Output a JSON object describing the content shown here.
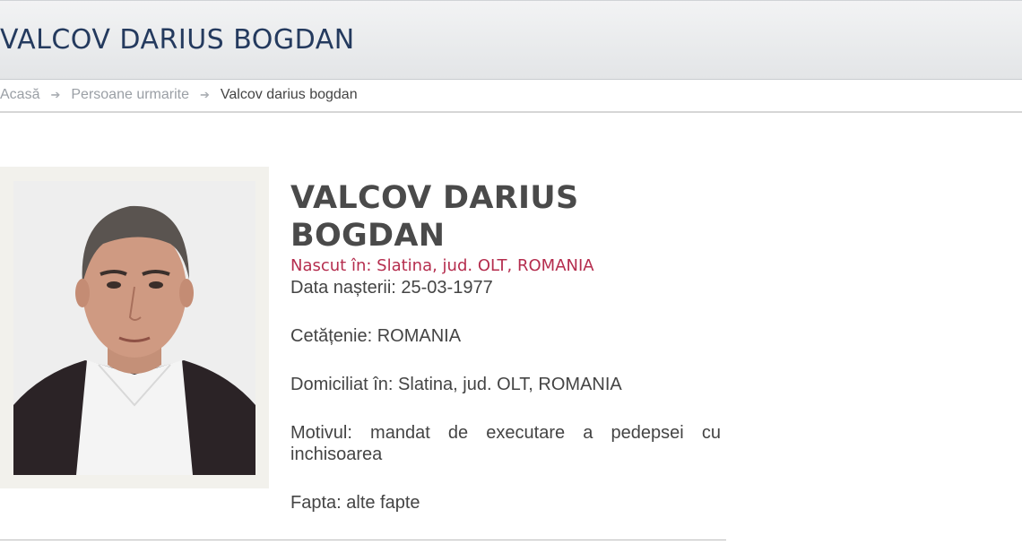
{
  "page": {
    "title": "VALCOV DARIUS BOGDAN"
  },
  "breadcrumb": {
    "items": [
      "Acasă",
      "Persoane urmarite"
    ],
    "current": "Valcov darius bogdan",
    "separator": "➔"
  },
  "person": {
    "name": "VALCOV DARIUS BOGDAN",
    "born": "Nascut în: Slatina, jud. OLT, ROMANIA",
    "birth_date": "Data nașterii: 25-03-1977",
    "citizenship": "Cetățenie: ROMANIA",
    "residence": "Domiciliat în: Slatina, jud. OLT, ROMANIA",
    "reason": "Motivul: mandat de executare a pedepsei cu inchisoarea",
    "deed": "Fapta: alte fapte"
  },
  "colors": {
    "header_title": "#243a5e",
    "born_accent": "#b52d4e",
    "name_text": "#4a4a4a"
  }
}
